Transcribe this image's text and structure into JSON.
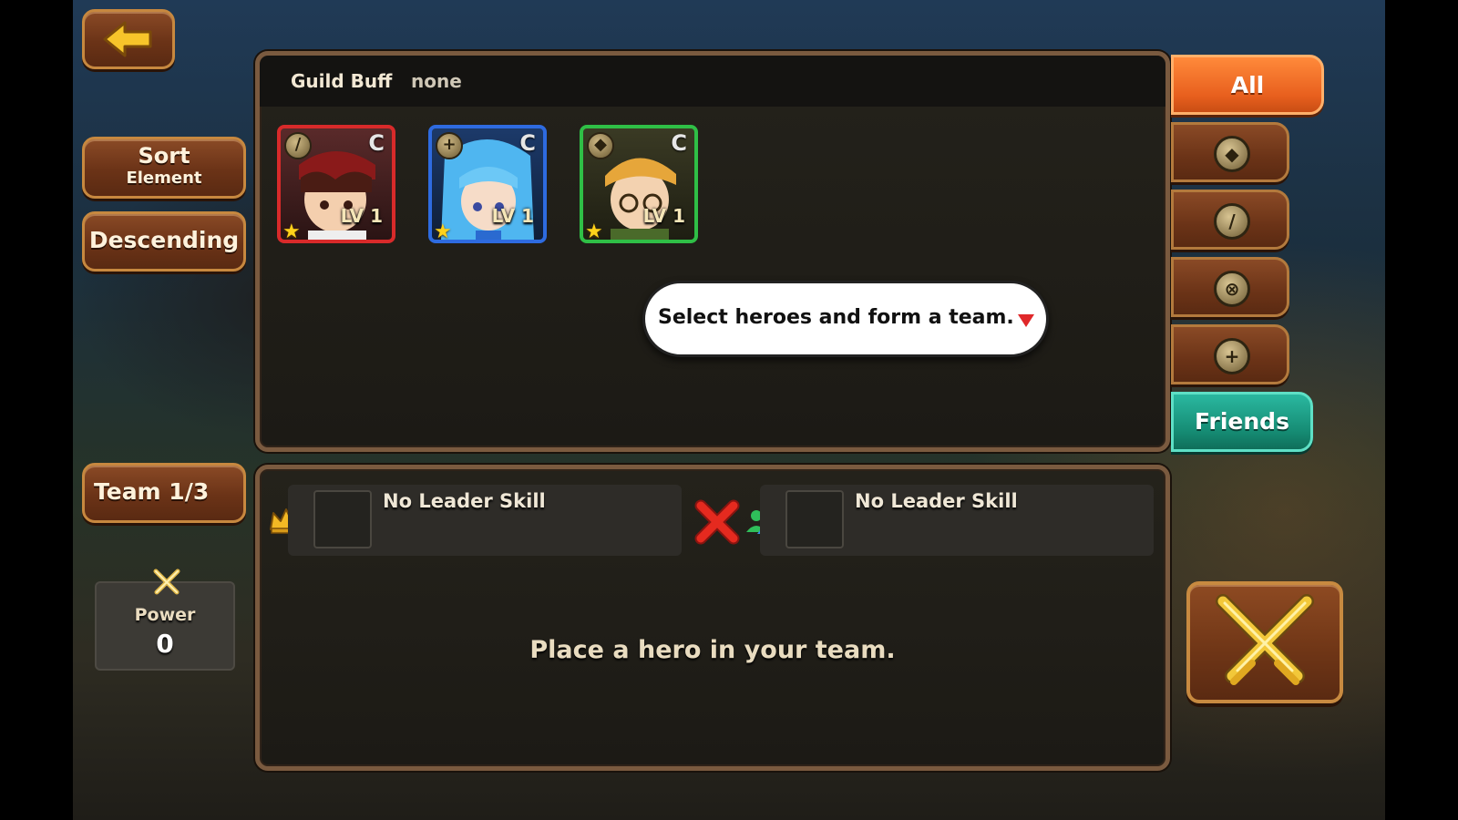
{
  "header": {
    "guild_buff_label": "Guild Buff",
    "guild_buff_value": "none"
  },
  "left_controls": {
    "back_icon": "arrow-left-icon",
    "sort_label": "Sort",
    "sort_value": "Element",
    "order_label": "Descending",
    "team_label": "Team 1/3",
    "power_icon": "crossed-swords-icon",
    "power_label": "Power",
    "power_value": "0"
  },
  "heroes": [
    {
      "frame_color": "#d82a2a",
      "class_icon": "sword-icon",
      "rank": "C",
      "level_label": "LV 1",
      "stars": 1
    },
    {
      "frame_color": "#2e6be0",
      "class_icon": "plus-icon",
      "rank": "C",
      "level_label": "LV 1",
      "stars": 1
    },
    {
      "frame_color": "#2fbf46",
      "class_icon": "shield-icon",
      "rank": "C",
      "level_label": "LV 1",
      "stars": 1
    }
  ],
  "tooltip": {
    "text": "Select heroes and form a team."
  },
  "filter_tabs": {
    "all_label": "All",
    "friends_label": "Friends",
    "class_icons": [
      "shield-icon",
      "sword-icon",
      "crosshair-icon",
      "plus-icon"
    ]
  },
  "team": {
    "leader_skill_label": "No Leader Skill",
    "friend_skill_label": "No Leader Skill",
    "empty_message": "Place a hero in your team."
  },
  "colors": {
    "all_tab": "#f07028",
    "friends_tab": "#1fa088",
    "close_x": "#e52a1f"
  }
}
